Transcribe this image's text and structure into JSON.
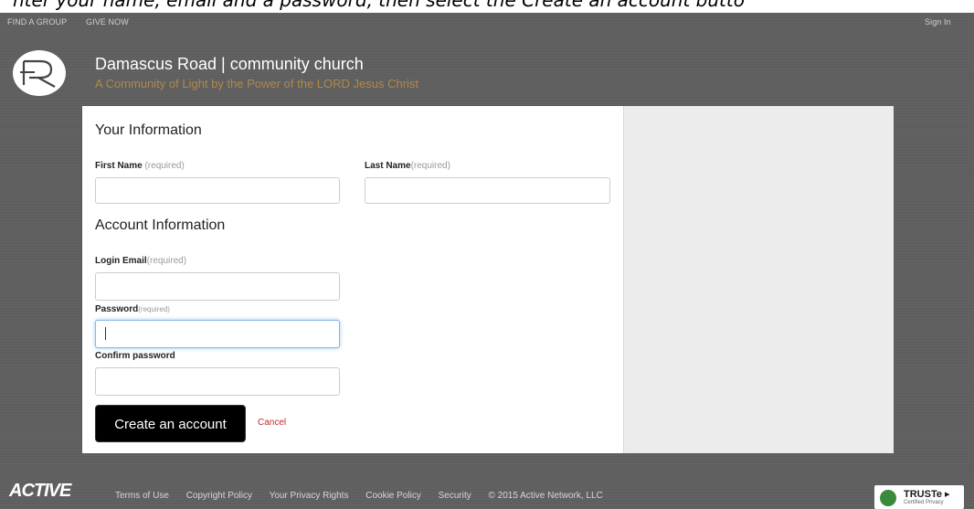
{
  "caption_fragment": "nter your name, email and a password, then select the Create an account butto",
  "nav": {
    "find_group": "FIND A GROUP",
    "give_now": "GIVE NOW",
    "sign_in": "Sign In"
  },
  "header": {
    "name": "Damascus Road | community church",
    "tagline": "A Community of Light by the Power of the LORD Jesus Christ"
  },
  "form": {
    "your_info_title": "Your Information",
    "first_name_label": "First Name",
    "first_name_req": " (required)",
    "last_name_label": "Last Name",
    "last_name_req": "(required)",
    "account_info_title": "Account Information",
    "login_email_label": "Login Email",
    "login_email_req": "(required)",
    "password_label": "Password",
    "password_req": "(required)",
    "confirm_label": "Confirm password",
    "create_button": "Create an account",
    "cancel_link": "Cancel"
  },
  "footer": {
    "logo_text": "ACTIVE",
    "links": [
      "Terms of Use",
      "Copyright Policy",
      "Your Privacy Rights",
      "Cookie Policy",
      "Security"
    ],
    "copyright": "© 2015 Active Network, LLC",
    "truste": "TRUSTe ▸",
    "truste_sub": "Certified Privacy"
  },
  "colors": {
    "accent_tag": "#b0884a",
    "cancel": "#c0282d",
    "button": "#000000"
  }
}
